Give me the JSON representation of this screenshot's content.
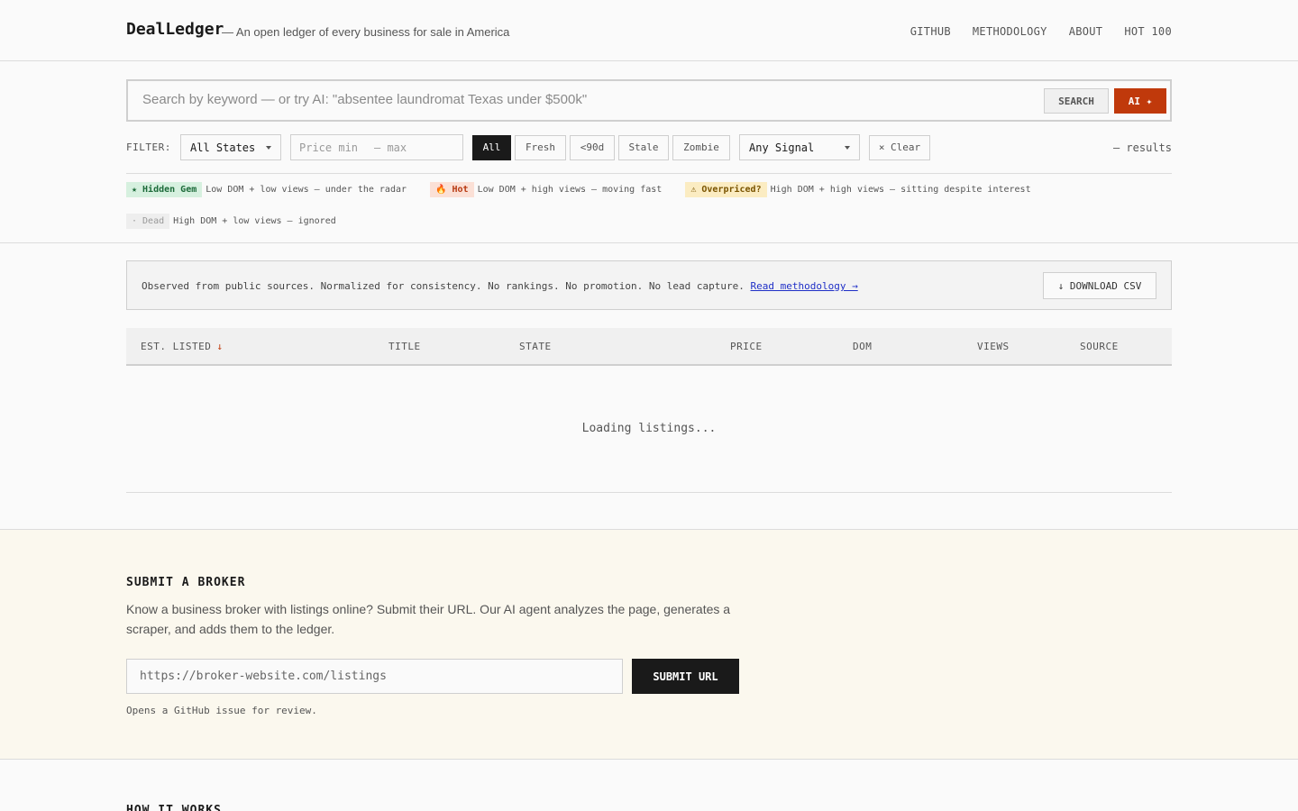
{
  "header": {
    "brand": "DealLedger",
    "tagline": "— An open ledger of every business for sale in America",
    "nav": [
      "GITHUB",
      "METHODOLOGY",
      "ABOUT",
      "HOT 100"
    ]
  },
  "search": {
    "placeholder": "Search by keyword — or try AI: \"absentee laundromat Texas under $500k\"",
    "search_label": "SEARCH",
    "ai_label": "AI ✦"
  },
  "filters": {
    "label": "FILTER:",
    "state_select": "All States",
    "price_min_placeholder": "Price min",
    "price_max_placeholder": "– max",
    "age_chips": [
      "All",
      "Fresh",
      "<90d",
      "Stale",
      "Zombie"
    ],
    "active_chip": "All",
    "signal_select": "Any Signal",
    "clear_label": "× Clear",
    "results": "— results"
  },
  "legend": [
    {
      "badge": "★ Hidden Gem",
      "desc": "Low DOM + low views — under the radar"
    },
    {
      "badge": "🔥 Hot",
      "desc": "Low DOM + high views — moving fast"
    },
    {
      "badge": "⚠ Overpriced?",
      "desc": "High DOM + high views — sitting despite interest"
    },
    {
      "badge": "· Dead",
      "desc": "High DOM + low views — ignored"
    }
  ],
  "notice": {
    "text": "Observed from public sources. Normalized for consistency. No rankings. No promotion. No lead capture.",
    "link": "Read methodology →",
    "csv_label": "↓ DOWNLOAD CSV"
  },
  "table": {
    "columns": [
      "EST. LISTED",
      "TITLE",
      "STATE",
      "PRICE",
      "DOM",
      "VIEWS",
      "SOURCE"
    ],
    "sort_indicator": "↓",
    "loading": "Loading listings..."
  },
  "submit": {
    "title": "SUBMIT A BROKER",
    "description": "Know a business broker with listings online? Submit their URL. Our AI agent analyzes the page, generates a scraper, and adds them to the ledger.",
    "url_placeholder": "https://broker-website.com/listings",
    "button": "SUBMIT URL",
    "note": "Opens a GitHub issue for review."
  },
  "next_section": {
    "title": "HOW IT WORKS"
  },
  "colors": {
    "accent": "#c0390b",
    "link": "#1f2fc7",
    "submit_bg": "#fbf8ee"
  }
}
